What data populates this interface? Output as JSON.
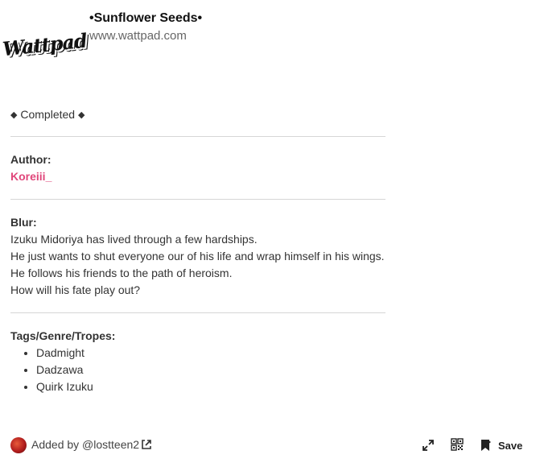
{
  "header": {
    "logo_text": "Wattpad",
    "title": "•Sunflower Seeds•",
    "site": "www.wattpad.com"
  },
  "content": {
    "status_prefix": "◆",
    "status_text": "Completed",
    "status_suffix": "◆",
    "author_label": "Author:",
    "author_name": "Koreiii_",
    "blur_label": "Blur:",
    "blur_lines": [
      "Izuku Midoriya has lived through a few hardships.",
      "He just wants to shut everyone our of his life and wrap himself in his wings.",
      "He follows his friends to the path of heroism.",
      "How will his fate play out?"
    ],
    "tags_label": "Tags/Genre/Tropes:",
    "tags": [
      "Dadmight",
      "Dadzawa",
      "Quirk Izuku"
    ]
  },
  "footer": {
    "added_by": "Added by @lostteen2",
    "save_label": "Save"
  },
  "colors": {
    "author_accent": "#e0467a",
    "separator": "#d6d6d6"
  },
  "icons": {
    "external": "external-link-icon",
    "expand": "expand-icon",
    "qr": "qr-code-icon",
    "save": "bookmark-icon"
  }
}
